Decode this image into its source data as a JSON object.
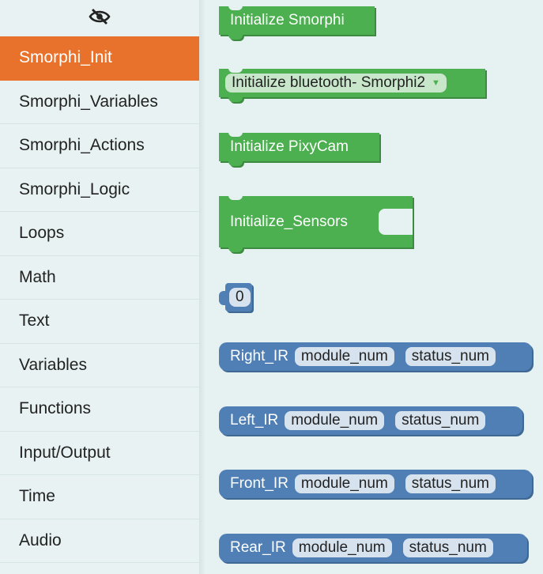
{
  "sidebar": {
    "categories": [
      {
        "label": "Smorphi_Init",
        "active": true
      },
      {
        "label": "Smorphi_Variables"
      },
      {
        "label": "Smorphi_Actions"
      },
      {
        "label": "Smorphi_Logic"
      },
      {
        "label": "Loops"
      },
      {
        "label": "Math"
      },
      {
        "label": "Text"
      },
      {
        "label": "Variables"
      },
      {
        "label": "Functions"
      },
      {
        "label": "Input/Output"
      },
      {
        "label": "Time"
      },
      {
        "label": "Audio"
      }
    ],
    "top_icon": "eye-slash-icon"
  },
  "blocks": {
    "init_smorphi": "Initialize Smorphi",
    "init_bluetooth": "Initialize bluetooth-",
    "bluetooth_option": "Smorphi2",
    "init_pixycam": "Initialize PixyCam",
    "init_sensors": "Initialize_Sensors",
    "number_value": "0",
    "right_ir": {
      "label": "Right_IR",
      "field1": "module_num",
      "field2": "status_num"
    },
    "left_ir": {
      "label": "Left_IR",
      "field1": "module_num",
      "field2": "status_num"
    },
    "front_ir": {
      "label": "Front_IR",
      "field1": "module_num",
      "field2": "status_num"
    },
    "rear_ir": {
      "label": "Rear_IR",
      "field1": "module_num",
      "field2": "status_num"
    }
  },
  "colors": {
    "active_category": "#e8712b",
    "init_blocks": "#4caf50",
    "sensor_blocks": "#4f7fb4"
  }
}
